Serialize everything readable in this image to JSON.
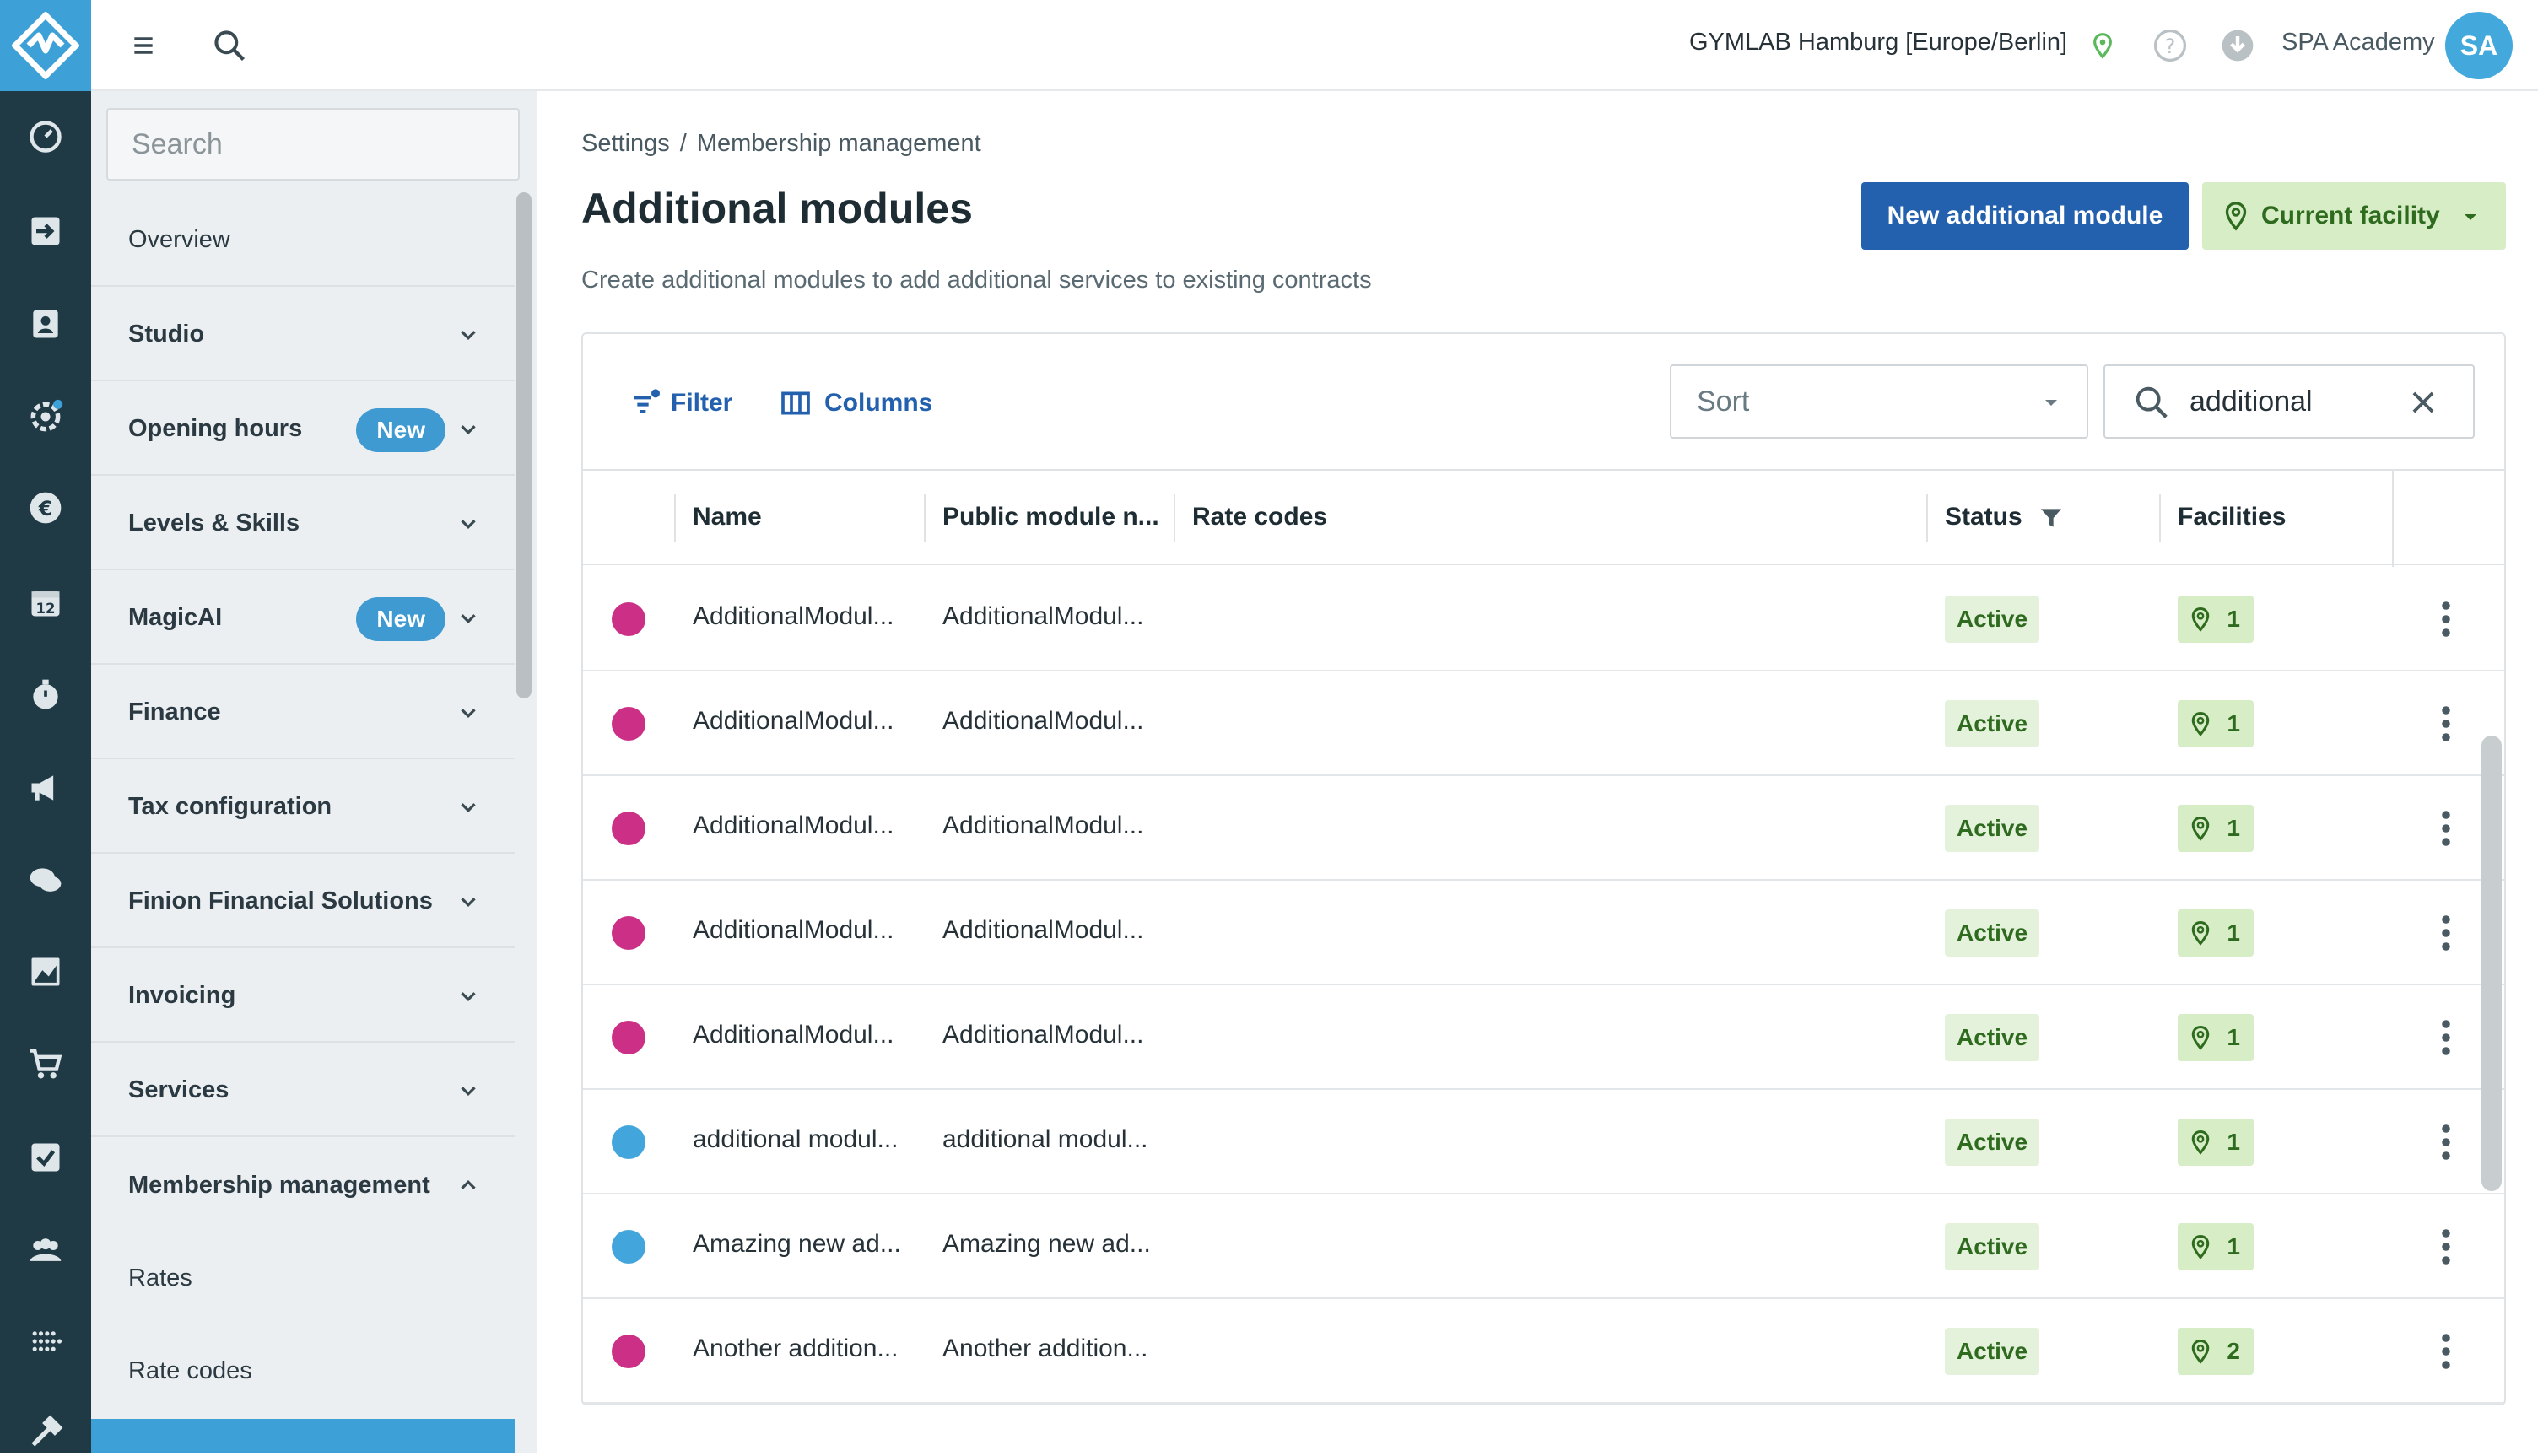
{
  "topbar": {
    "facility": "GYMLAB Hamburg [Europe/Berlin]",
    "user": "SPA Academy",
    "avatar_initials": "SA"
  },
  "sidebar": {
    "search_placeholder": "Search",
    "items": [
      {
        "label": "Overview"
      },
      {
        "label": "Studio"
      },
      {
        "label": "Opening hours",
        "badge": "New"
      },
      {
        "label": "Levels & Skills"
      },
      {
        "label": "MagicAI",
        "badge": "New"
      },
      {
        "label": "Finance"
      },
      {
        "label": "Tax configuration"
      },
      {
        "label": "Finion Financial Solutions"
      },
      {
        "label": "Invoicing"
      },
      {
        "label": "Services"
      },
      {
        "label": "Membership management"
      }
    ],
    "sub_items": [
      {
        "label": "Rates"
      },
      {
        "label": "Rate codes"
      }
    ]
  },
  "breadcrumb": {
    "root": "Settings",
    "separator": "/",
    "current": "Membership management"
  },
  "page": {
    "title": "Additional modules",
    "subtitle": "Create additional modules to add additional services to existing contracts",
    "new_button": "New additional module",
    "facility_button": "Current facility"
  },
  "toolbar": {
    "filter": "Filter",
    "columns": "Columns",
    "sort_placeholder": "Sort",
    "search_value": "additional"
  },
  "table": {
    "headers": {
      "name": "Name",
      "public_name": "Public module n...",
      "rate_codes": "Rate codes",
      "status": "Status",
      "facilities": "Facilities"
    },
    "rows": [
      {
        "color": "#cc2f86",
        "name": "AdditionalModul...",
        "public_name": "AdditionalModul...",
        "status": "Active",
        "facilities": "1"
      },
      {
        "color": "#cc2f86",
        "name": "AdditionalModul...",
        "public_name": "AdditionalModul...",
        "status": "Active",
        "facilities": "1"
      },
      {
        "color": "#cc2f86",
        "name": "AdditionalModul...",
        "public_name": "AdditionalModul...",
        "status": "Active",
        "facilities": "1"
      },
      {
        "color": "#cc2f86",
        "name": "AdditionalModul...",
        "public_name": "AdditionalModul...",
        "status": "Active",
        "facilities": "1"
      },
      {
        "color": "#cc2f86",
        "name": "AdditionalModul...",
        "public_name": "AdditionalModul...",
        "status": "Active",
        "facilities": "1"
      },
      {
        "color": "#42a5dc",
        "name": "additional modul...",
        "public_name": "additional modul...",
        "status": "Active",
        "facilities": "1"
      },
      {
        "color": "#42a5dc",
        "name": "Amazing new ad...",
        "public_name": "Amazing new ad...",
        "status": "Active",
        "facilities": "1"
      },
      {
        "color": "#cc2f86",
        "name": "Another addition...",
        "public_name": "Another addition...",
        "status": "Active",
        "facilities": "2"
      }
    ]
  },
  "colors": {
    "rail": "#1f3a45",
    "accent": "#3da0d6",
    "primary": "#2360ae",
    "success_bg": "#d6edc6",
    "success_text": "#2f6b1f"
  }
}
